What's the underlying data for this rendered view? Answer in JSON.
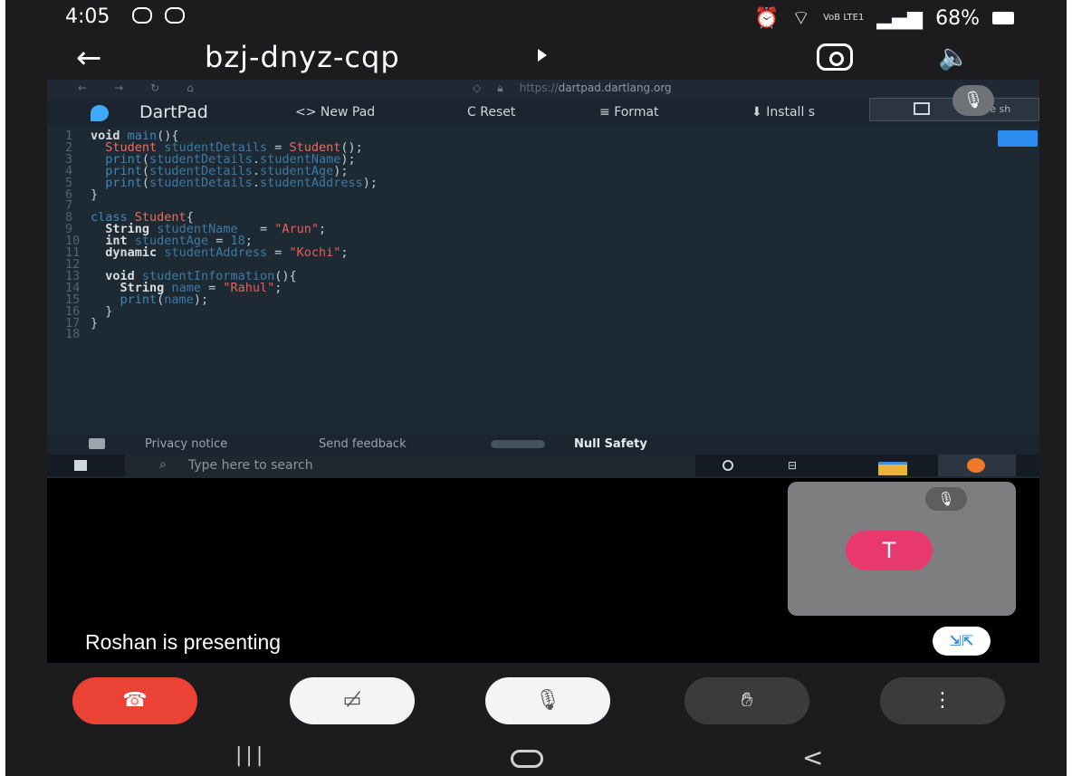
{
  "status_bar": {
    "time": "4:05",
    "network": "VoB LTE1",
    "battery": "68%"
  },
  "meeting": {
    "code": "bzj-dnyz-cqp",
    "presenting": "Roshan is presenting",
    "participant_initial": "T"
  },
  "browser": {
    "url_prefix": "https://",
    "url_host": "dartpad.dartlang.org"
  },
  "dartpad": {
    "title": "DartPad",
    "new_pad": "<> New Pad",
    "reset": "C Reset",
    "format": "Format",
    "install": "Install s",
    "call_window_text": "You're sh"
  },
  "footer": {
    "privacy": "Privacy notice",
    "feedback": "Send feedback",
    "null_safety": "Null Safety"
  },
  "taskbar": {
    "search_placeholder": "Type here to search"
  },
  "code_lines": [
    "void main(){",
    "  Student studentDetails = Student();",
    "  print(studentDetails.studentName);",
    "  print(studentDetails.studentAge);",
    "  print(studentDetails.studentAddress);",
    "}",
    "",
    "class Student{",
    "  String studentName   = \"Arun\";",
    "  int studentAge = 18;",
    "  dynamic studentAddress = \"Kochi\";",
    "",
    "  void studentInformation(){",
    "    String name = \"Rahul\";",
    "    print(name);",
    "  }",
    "}",
    ""
  ],
  "icons": {
    "back": "arrow-left-icon",
    "switch_camera": "camera-switch-icon",
    "speaker": "speaker-icon",
    "end_call": "phone-hangup-icon",
    "camera_off": "video-off-icon",
    "mic_off": "mic-off-icon",
    "raise_hand": "hand-icon",
    "more": "more-vertical-icon"
  },
  "colors": {
    "end_call": "#ea4335",
    "avatar": "#e8396f",
    "dartpad_bg": "#1e2a33"
  }
}
